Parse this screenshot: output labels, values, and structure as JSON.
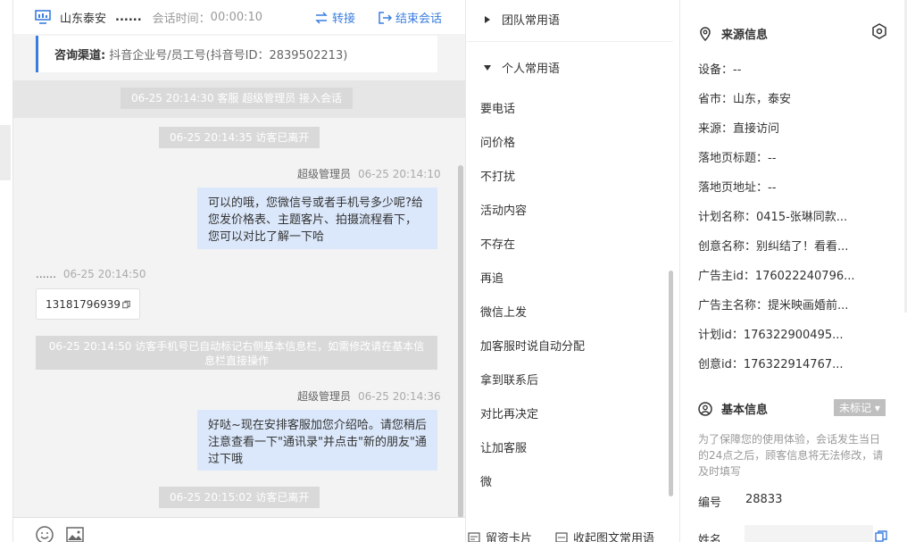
{
  "header": {
    "location": "山东泰安",
    "visitor_name": "......",
    "session_time_label": "会话时间：",
    "session_time_value": "00:00:10",
    "transfer_label": "转接",
    "end_label": "结束会话"
  },
  "channel": {
    "label": "咨询渠道:",
    "value": "抖音企业号/员工号(抖音号ID：2839502213)"
  },
  "messages": {
    "sys1": "06-25 20:14:30 客服 超级管理员 接入会话",
    "sys2": "06-25 20:14:35 访客已离开",
    "agent1_name": "超级管理员",
    "agent1_time": "06-25 20:14:10",
    "agent1_text": "可以的哦，您微信号或者手机号多少呢?给您发价格表、主题客片、拍摄流程看下，您可以对比了解一下哈",
    "visitor_name": "......",
    "visitor_time": "06-25 20:14:50",
    "visitor_text": "13181796939",
    "sys3": "06-25 20:14:50 访客手机号已自动标记右侧基本信息栏，如需修改请在基本信息栏直接操作",
    "agent2_name": "超级管理员",
    "agent2_time": "06-25 20:14:36",
    "agent2_text": "好哒~现在安排客服加您介绍哈。请您稍后注意查看一下\"通讯录\"并点击\"新的朋友\"通过下哦",
    "sys4": "06-25 20:15:02 访客已离开"
  },
  "phrases": {
    "team_group": "团队常用语",
    "personal_group": "个人常用语",
    "items": [
      "要电话",
      "问价格",
      "不打扰",
      "活动内容",
      "不存在",
      "再追",
      "微信上发",
      "加客服时说自动分配",
      "拿到联系后",
      "对比再决定",
      "让加客服",
      "微"
    ],
    "footer_card": "留资卡片",
    "footer_collapse": "收起图文常用语"
  },
  "source_info": {
    "title": "来源信息",
    "rows": [
      "设备：--",
      "省市：山东，泰安",
      "来源：直接访问",
      "落地页标题：--",
      "落地页地址：--",
      "计划名称：0415-张琳同款...",
      "创意名称：别纠结了！看看...",
      "广告主id：176022240796...",
      "广告主名称：提米映画婚前...",
      "计划id：176322900495...",
      "创意id：176322914767..."
    ]
  },
  "basic_info": {
    "title": "基本信息",
    "tag": "未标记",
    "note": "为了保障您的使用体验，会话发生当日的24点之后，顾客信息将无法修改，请及时填写",
    "id_label": "编号",
    "id_value": "28833",
    "name_label": "姓名"
  },
  "colors": {
    "accent": "#3a7de0",
    "agent_bubble": "#dbe8fb",
    "system_pill": "#d9d9d9"
  }
}
